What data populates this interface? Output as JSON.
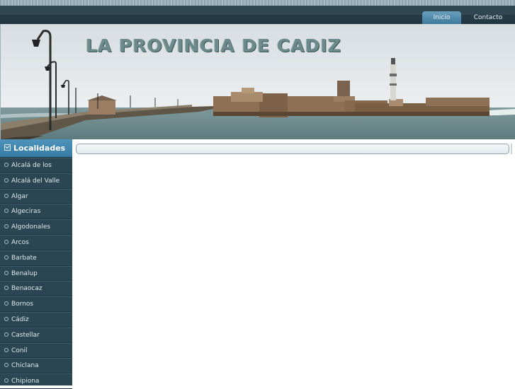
{
  "nav": {
    "items": [
      {
        "label": "Inicio",
        "active": true
      },
      {
        "label": "Contacto",
        "active": false
      }
    ]
  },
  "banner": {
    "title": "LA PROVINCIA DE CADIZ"
  },
  "sidebar": {
    "header": "Localidades",
    "items": [
      {
        "label": "Alcalá de los"
      },
      {
        "label": "Alcalá del Valle"
      },
      {
        "label": "Algar"
      },
      {
        "label": "Algeciras"
      },
      {
        "label": "Algodonales"
      },
      {
        "label": "Arcos"
      },
      {
        "label": "Barbate"
      },
      {
        "label": "Benalup"
      },
      {
        "label": "Benaocaz"
      },
      {
        "label": "Bornos"
      },
      {
        "label": "Cádiz"
      },
      {
        "label": "Castellar"
      },
      {
        "label": "Conil"
      },
      {
        "label": "Chiclana"
      },
      {
        "label": "Chipiona"
      }
    ]
  },
  "colors": {
    "nav_bg": "#2e4753",
    "active_tab": "#4f8db0",
    "sidebar_bg": "#2b4653",
    "sidebar_header": "#4d94bd"
  }
}
